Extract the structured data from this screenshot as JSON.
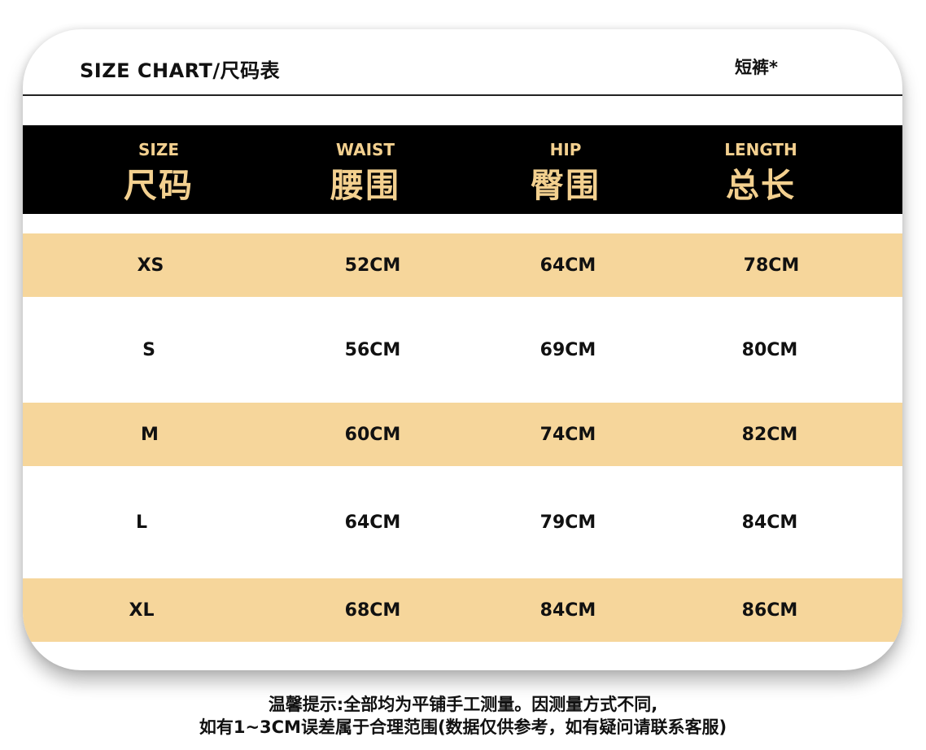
{
  "header": {
    "title": "SIZE CHART/尺码表",
    "subtitle": "短裤*"
  },
  "columns": [
    {
      "en": "SIZE",
      "zh": "尺码"
    },
    {
      "en": "WAIST",
      "zh": "腰围"
    },
    {
      "en": "HIP",
      "zh": "臀围"
    },
    {
      "en": "LENGTH",
      "zh": "总长"
    }
  ],
  "rows": [
    {
      "size": "XS",
      "waist": "52CM",
      "hip": "64CM",
      "length": "78CM"
    },
    {
      "size": "S",
      "waist": "56CM",
      "hip": "69CM",
      "length": "80CM"
    },
    {
      "size": "M",
      "waist": "60CM",
      "hip": "74CM",
      "length": "82CM"
    },
    {
      "size": "L",
      "waist": "64CM",
      "hip": "79CM",
      "length": "84CM"
    },
    {
      "size": "XL",
      "waist": "68CM",
      "hip": "84CM",
      "length": "86CM"
    }
  ],
  "notes": {
    "line1": "温馨提示:全部均为平铺手工测量。因测量方式不同,",
    "line2": "如有1~3CM误差属于合理范围(数据仅供参考，如有疑问请联系客服)"
  },
  "colors": {
    "header_bg": "#000000",
    "header_text": "#f3d08f",
    "stripe": "#f6d69b"
  }
}
